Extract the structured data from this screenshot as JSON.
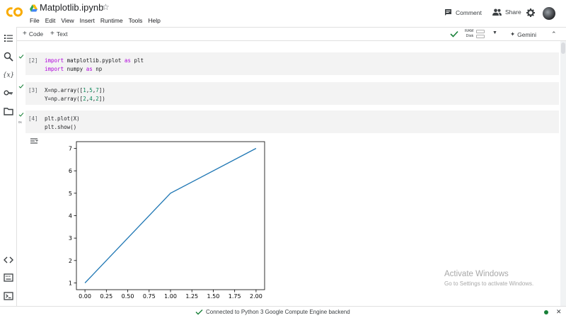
{
  "header": {
    "logo_text": "CO",
    "title": "Matplotlib.ipynb",
    "menu": [
      "File",
      "Edit",
      "View",
      "Insert",
      "Runtime",
      "Tools",
      "Help"
    ],
    "comment_label": "Comment",
    "share_label": "Share"
  },
  "toolbar": {
    "code_label": "Code",
    "text_label": "Text",
    "ram_label": "RAM",
    "disk_label": "Disk",
    "gemini_label": "Gemini"
  },
  "cells": [
    {
      "number": "[2]",
      "lines": [
        "import matplotlib.pyplot as plt",
        "import numpy as np"
      ]
    },
    {
      "number": "[3]",
      "lines": [
        "X=np.array([1,5,7])",
        "Y=np.array([2,4,2])"
      ]
    },
    {
      "number": "[4]",
      "lines": [
        "plt.plot(X)",
        "plt.show()"
      ],
      "exec_time": "0s"
    }
  ],
  "chart_data": {
    "type": "line",
    "x": [
      0,
      1,
      2
    ],
    "series": [
      {
        "values": [
          1,
          5,
          7
        ],
        "color": "#1f77b4"
      }
    ],
    "xticks": [
      "0.00",
      "0.25",
      "0.50",
      "0.75",
      "1.00",
      "1.25",
      "1.50",
      "1.75",
      "2.00"
    ],
    "yticks": [
      "1",
      "2",
      "3",
      "4",
      "5",
      "6",
      "7"
    ],
    "xlim": [
      -0.1,
      2.1
    ],
    "ylim": [
      0.7,
      7.3
    ],
    "grid": false,
    "title": "",
    "xlabel": "",
    "ylabel": ""
  },
  "watermark": {
    "title": "Activate Windows",
    "subtitle": "Go to Settings to activate Windows."
  },
  "statusbar": {
    "text": "Connected to Python 3 Google Compute Engine backend"
  },
  "colors": {
    "logo_orange": "#f9ab00",
    "status_green": "#188038",
    "keyword_purple": "#af00db",
    "number_green": "#098658",
    "line_blue": "#1f77b4"
  }
}
